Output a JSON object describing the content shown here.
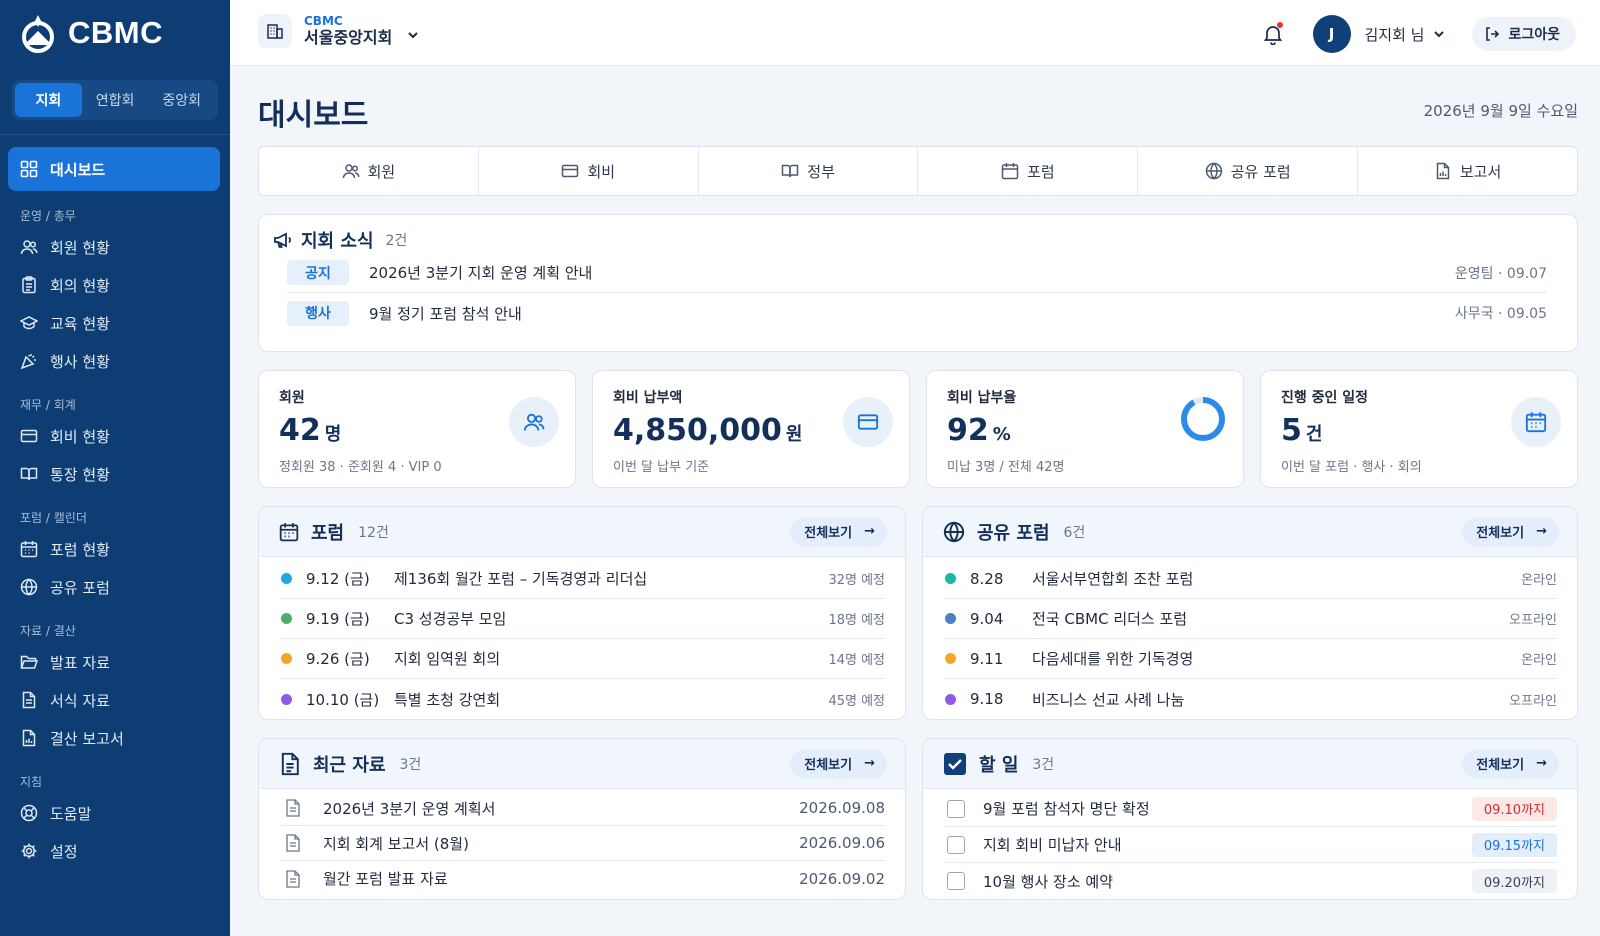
{
  "brand": {
    "name": "CBMC"
  },
  "scope_tabs": [
    "지회",
    "연합회",
    "중앙회"
  ],
  "nav": {
    "dashboard": "대시보드",
    "groups": [
      {
        "title": "운영 / 총무",
        "items": [
          "회원 현황",
          "회의 현황",
          "교육 현황",
          "행사 현황"
        ]
      },
      {
        "title": "재무 / 회계",
        "items": [
          "회비 현황",
          "통장 현황"
        ]
      },
      {
        "title": "포럼 / 캘린더",
        "items": [
          "포럼 현황",
          "공유 포럼"
        ]
      },
      {
        "title": "자료 / 결산",
        "items": [
          "발표 자료",
          "서식 자료",
          "결산 보고서"
        ]
      },
      {
        "title": "지침",
        "items": [
          "도움말",
          "설정"
        ]
      }
    ]
  },
  "header": {
    "org_small": "CBMC",
    "org_name": "서울중앙지회",
    "avatar": "J",
    "user_name": "김지회 님",
    "logout": "로그아웃"
  },
  "page": {
    "title": "대시보드",
    "date": "2026년 9월 9일 수요일"
  },
  "quick_tabs": [
    "회원",
    "회비",
    "정부",
    "포럼",
    "공유 포럼",
    "보고서"
  ],
  "news": {
    "title": "지회 소식",
    "count": "2건",
    "items": [
      {
        "tag": "공지",
        "text": "2026년 3분기 지회 운영 계획 안내",
        "author": "운영팀",
        "date": "09.07"
      },
      {
        "tag": "행사",
        "text": "9월 정기 포럼 참석 안내",
        "author": "사무국",
        "date": "09.05"
      }
    ]
  },
  "stats": [
    {
      "label": "회원",
      "value": "42",
      "unit": "명",
      "sub": "정회원 38 · 준회원 4 · VIP 0"
    },
    {
      "label": "회비 납부액",
      "value": "4,850,000",
      "unit": "원",
      "sub": "이번 달 납부 기준"
    },
    {
      "label": "회비 납부율",
      "value": "92",
      "unit": "%",
      "sub": "미납 3명 / 전체 42명",
      "rate": 0.92
    },
    {
      "label": "진행 중인 일정",
      "value": "5",
      "unit": "건",
      "sub": "이번 달 포럼 · 행사 · 회의"
    }
  ],
  "forum": {
    "title": "포럼",
    "count": "12건",
    "view_all": "전체보기",
    "items": [
      {
        "date": "9.12 (금)",
        "title": "제136회 월간 포럼 – 기독경영과 리더십",
        "meta": "32명 예정",
        "color": "#1ea7e8"
      },
      {
        "date": "9.19 (금)",
        "title": "C3 성경공부 모임",
        "meta": "18명 예정",
        "color": "#4caf6e"
      },
      {
        "date": "9.26 (금)",
        "title": "지회 임역원 회의",
        "meta": "14명 예정",
        "color": "#f5a623"
      },
      {
        "date": "10.10 (금)",
        "title": "특별 초청 강연회",
        "meta": "45명 예정",
        "color": "#8e5ce0"
      }
    ]
  },
  "shared_forum": {
    "title": "공유 포럼",
    "count": "6건",
    "view_all": "전체보기",
    "items": [
      {
        "date": "8.28",
        "title": "서울서부연합회 조찬 포럼",
        "meta": "온라인",
        "color": "#17b8a6"
      },
      {
        "date": "9.04",
        "title": "전국 CBMC 리더스 포럼",
        "meta": "오프라인",
        "color": "#4a7fc8"
      },
      {
        "date": "9.11",
        "title": "다음세대를 위한 기독경영",
        "meta": "온라인",
        "color": "#f5a623"
      },
      {
        "date": "9.18",
        "title": "비즈니스 선교 사례 나눔",
        "meta": "오프라인",
        "color": "#8e5ce0"
      }
    ]
  },
  "recent_docs": {
    "title": "최근 자료",
    "count": "3건",
    "view_all": "전체보기",
    "items": [
      {
        "title": "2026년 3분기 운영 계획서",
        "date": "2026.09.08"
      },
      {
        "title": "지회 회계 보고서 (8월)",
        "date": "2026.09.06"
      },
      {
        "title": "월간 포럼 발표 자료",
        "date": "2026.09.02"
      }
    ]
  },
  "todo": {
    "title": "할 일",
    "count": "3건",
    "view_all": "전체보기",
    "items": [
      {
        "title": "9월 포럼 참석자 명단 확정",
        "due": "09.10까지",
        "tone": "red"
      },
      {
        "title": "지회 회비 미납자 안내",
        "due": "09.15까지",
        "tone": "blue"
      },
      {
        "title": "10월 행사 장소 예약",
        "due": "09.20까지",
        "tone": "grey"
      }
    ]
  },
  "colors": {
    "sidebar": "#0e3d73",
    "accent": "#1a73d9",
    "title": "#13305a"
  }
}
